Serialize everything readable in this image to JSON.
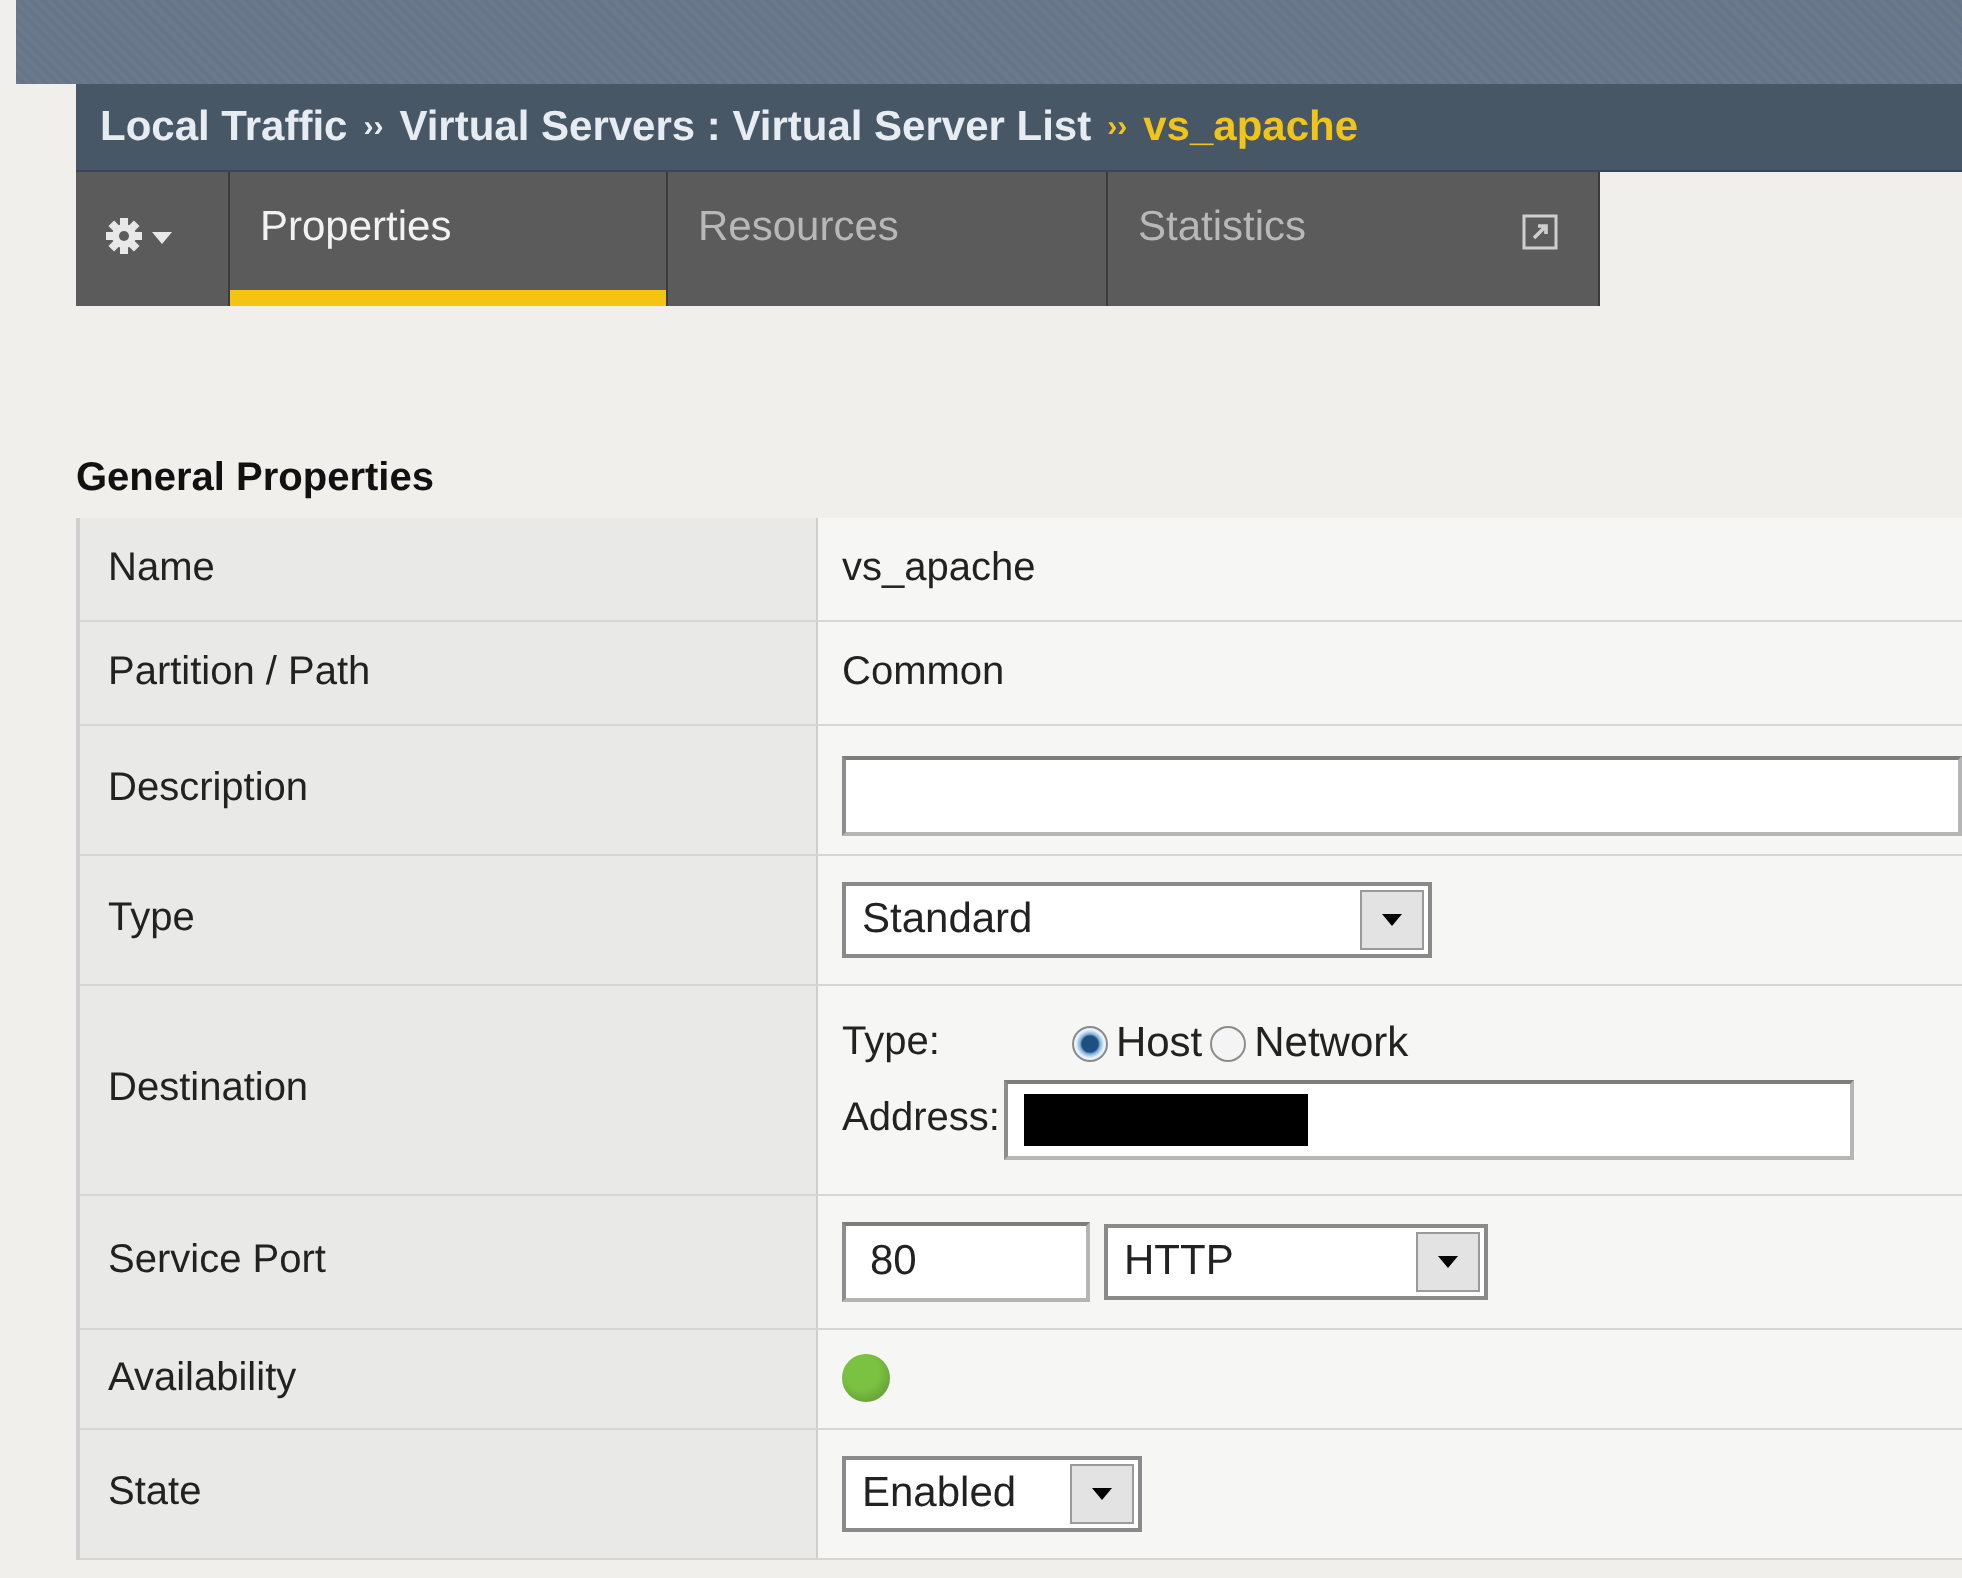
{
  "breadcrumb": [
    {
      "kind": "link",
      "label": "Local Traffic"
    },
    {
      "kind": "separator",
      "label": "››"
    },
    {
      "kind": "link",
      "label": "Virtual Servers : Virtual Server List"
    },
    {
      "kind": "separator",
      "label": "››"
    },
    {
      "kind": "current",
      "label": "vs_apache"
    }
  ],
  "tabs": [
    {
      "kind": "menu",
      "selected": false
    },
    {
      "kind": "tab",
      "label": "Properties",
      "selected": true
    },
    {
      "kind": "tab",
      "label": "Resources",
      "selected": false
    },
    {
      "kind": "tab",
      "label": "Statistics",
      "selected": false,
      "external": true
    }
  ],
  "section_title": "General Properties",
  "rows": [
    {
      "label": "Name",
      "kind": "text",
      "value": "vs_apache"
    },
    {
      "label": "Partition / Path",
      "kind": "text",
      "value": "Common"
    },
    {
      "label": "Description",
      "kind": "input"
    },
    {
      "label": "Type",
      "kind": "select",
      "value": "Standard"
    },
    {
      "label": "Destination",
      "kind": "destination",
      "type_label": "Type:",
      "options": [
        {
          "label": "Host",
          "selected": true
        },
        {
          "label": "Network",
          "selected": false
        }
      ],
      "address_label": "Address:",
      "address_redacted": true
    },
    {
      "label": "Service Port",
      "kind": "port",
      "port": "80",
      "protocol": "HTTP"
    },
    {
      "label": "Availability",
      "kind": "status",
      "color": "#7cc242"
    },
    {
      "label": "State",
      "kind": "select",
      "value": "Enabled"
    }
  ]
}
